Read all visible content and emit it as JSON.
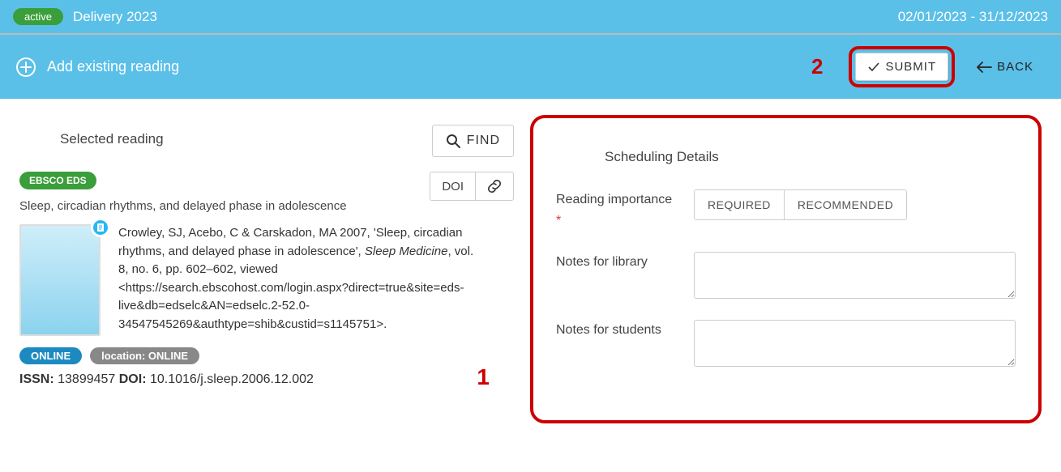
{
  "top": {
    "status": "active",
    "delivery": "Delivery 2023",
    "date_range": "02/01/2023 - 31/12/2023"
  },
  "subbar": {
    "title": "Add existing reading",
    "submit_label": "SUBMIT",
    "back_label": "BACK",
    "annot_2": "2"
  },
  "left": {
    "heading": "Selected reading",
    "find_label": "FIND",
    "doi_label": "DOI",
    "source_badge": "EBSCO EDS",
    "title": "Sleep, circadian rhythms, and delayed phase in adolescence",
    "citation_prefix": "Crowley, SJ, Acebo, C & Carskadon, MA 2007, 'Sleep, circadian rhythms, and delayed phase in adolescence', ",
    "citation_journal": "Sleep Medicine",
    "citation_suffix": ", vol. 8, no. 6, pp. 602–602, viewed <https://search.ebscohost.com/login.aspx?direct=true&site=eds-live&db=edselc&AN=edselc.2-52.0-34547545269&authtype=shib&custid=s1145751>.",
    "pill_online": "ONLINE",
    "pill_location": "location: ONLINE",
    "issn_label": "ISSN:",
    "issn_value": " 13899457 ",
    "doi_label2": "DOI:",
    "doi_value": " 10.1016/j.sleep.2006.12.002",
    "annot_1": "1"
  },
  "right": {
    "heading": "Scheduling Details",
    "importance_label": "Reading importance ",
    "importance_req": "*",
    "opt_required": "REQUIRED",
    "opt_recommended": "RECOMMENDED",
    "notes_library_label": "Notes for library",
    "notes_students_label": "Notes for students"
  }
}
